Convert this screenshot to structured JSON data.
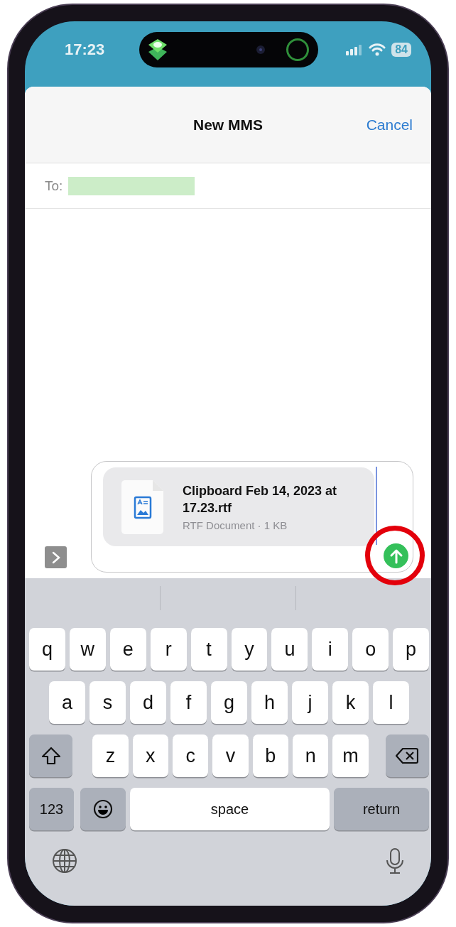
{
  "status_bar": {
    "time": "17:23",
    "battery": "84"
  },
  "header": {
    "title": "New MMS",
    "cancel": "Cancel"
  },
  "recipient": {
    "label": "To:"
  },
  "attachment": {
    "name": "Clipboard Feb 14, 2023 at 17.23.rtf",
    "details": "RTF Document · 1 KB"
  },
  "keyboard": {
    "key_rows": [
      {
        "keys": [
          {
            "kind": "letter",
            "label": "q"
          },
          {
            "kind": "letter",
            "label": "w"
          },
          {
            "kind": "letter",
            "label": "e"
          },
          {
            "kind": "letter",
            "label": "r"
          },
          {
            "kind": "letter",
            "label": "t"
          },
          {
            "kind": "letter",
            "label": "y"
          },
          {
            "kind": "letter",
            "label": "u"
          },
          {
            "kind": "letter",
            "label": "i"
          },
          {
            "kind": "letter",
            "label": "o"
          },
          {
            "kind": "letter",
            "label": "p"
          }
        ]
      },
      {
        "keys": [
          {
            "kind": "letter",
            "label": "a"
          },
          {
            "kind": "letter",
            "label": "s"
          },
          {
            "kind": "letter",
            "label": "d"
          },
          {
            "kind": "letter",
            "label": "f"
          },
          {
            "kind": "letter",
            "label": "g"
          },
          {
            "kind": "letter",
            "label": "h"
          },
          {
            "kind": "letter",
            "label": "j"
          },
          {
            "kind": "letter",
            "label": "k"
          },
          {
            "kind": "letter",
            "label": "l"
          }
        ]
      },
      {
        "keys": [
          {
            "kind": "shift"
          },
          {
            "kind": "letter",
            "label": "z"
          },
          {
            "kind": "letter",
            "label": "x"
          },
          {
            "kind": "letter",
            "label": "c"
          },
          {
            "kind": "letter",
            "label": "v"
          },
          {
            "kind": "letter",
            "label": "b"
          },
          {
            "kind": "letter",
            "label": "n"
          },
          {
            "kind": "letter",
            "label": "m"
          },
          {
            "kind": "delete"
          }
        ]
      },
      {
        "keys": [
          {
            "kind": "numbers",
            "label": "123"
          },
          {
            "kind": "emoji"
          },
          {
            "kind": "space",
            "label": "space"
          },
          {
            "kind": "action",
            "label": "return"
          }
        ]
      }
    ]
  }
}
